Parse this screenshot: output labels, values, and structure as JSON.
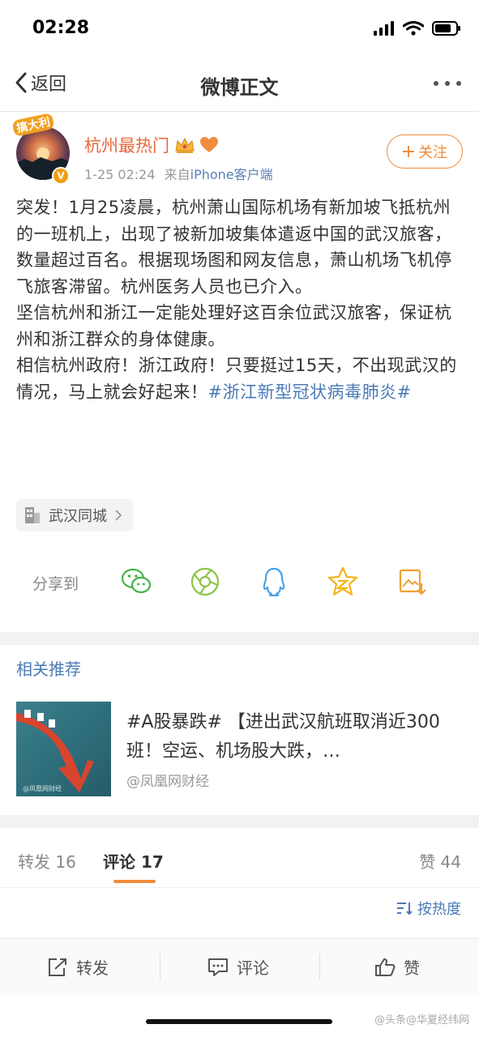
{
  "status_bar": {
    "time": "02:28"
  },
  "nav": {
    "back_label": "返回",
    "title": "微博正文"
  },
  "post": {
    "avatar_sticker": "搞大利",
    "username": "杭州最热门",
    "date": "1-25 02:24",
    "source_prefix": "来自",
    "source": "iPhone客户端",
    "follow_label": "关注",
    "paragraphs": [
      "突发！1月25凌晨，杭州萧山国际机场有新加坡飞抵杭州的一班机上，出现了被新加坡集体遣返中国的武汉旅客，数量超过百名。根据现场图和网友信息，萧山机场飞机停飞旅客滞留。杭州医务人员也已介入。",
      "坚信杭州和浙江一定能处理好这百余位武汉旅客，保证杭州和浙江群众的身体健康。"
    ],
    "last_paragraph_text": "相信杭州政府！浙江政府！只要挺过15天，不出现武汉的情况，马上就会好起来！",
    "hashtag": "#浙江新型冠状病毒肺炎#",
    "location": "武汉同城"
  },
  "share": {
    "label": "分享到",
    "targets": [
      "wechat-icon",
      "moments-icon",
      "qq-icon",
      "qzone-icon",
      "save-image-icon"
    ]
  },
  "related": {
    "title": "相关推荐",
    "headline": "#A股暴跌# 【进出武汉航班取消近300班！空运、机场股大跌，…",
    "source": "@凤凰网财经"
  },
  "tabs": {
    "repost": "转发 16",
    "comment": "评论 17",
    "like": "赞 44"
  },
  "sort_label": "按热度",
  "bottom_bar": {
    "repost": "转发",
    "comment": "评论",
    "like": "赞"
  },
  "watermark": "@头条@华夏经纬网",
  "colors": {
    "accent_orange": "#f08c3c",
    "link_blue": "#4b7bb6",
    "username_orange": "#e8693a"
  }
}
